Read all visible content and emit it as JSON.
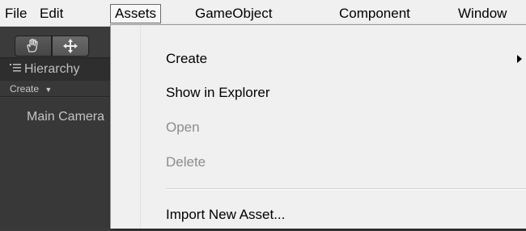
{
  "menubar": {
    "items": [
      "File",
      "Edit",
      "Assets",
      "GameObject",
      "Component",
      "Window"
    ]
  },
  "hierarchy": {
    "title": "Hierarchy",
    "create_label": "Create",
    "items": [
      "Main Camera"
    ]
  },
  "assets_menu": {
    "items": [
      {
        "label": "Create",
        "enabled": true,
        "submenu": true
      },
      {
        "label": "Show in Explorer",
        "enabled": true
      },
      {
        "label": "Open",
        "enabled": false
      },
      {
        "label": "Delete",
        "enabled": false
      },
      {
        "label": "Import New Asset...",
        "enabled": true
      }
    ]
  },
  "colors": {
    "menu_bg": "#f0f0f0",
    "disabled_text": "#8c8c8c",
    "editor_dark": "#3e3e3e"
  }
}
